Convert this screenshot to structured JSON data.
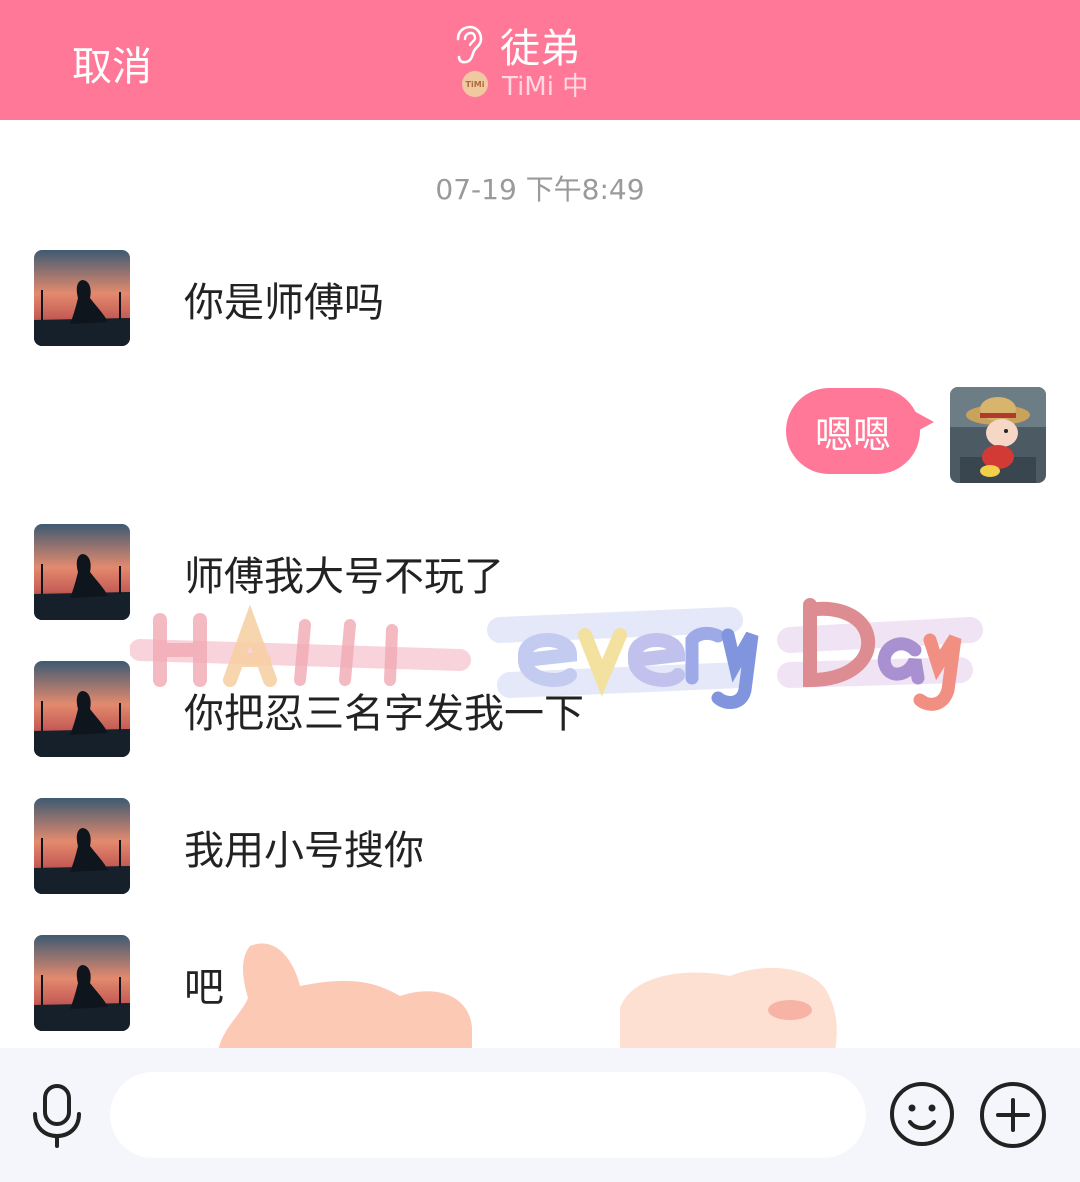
{
  "header": {
    "cancel_label": "取消",
    "title": "徒弟",
    "subtitle": "TiMi 中",
    "timi_badge": "TiMi",
    "title_icon": "ear-icon",
    "background": "#ff7898"
  },
  "chat": {
    "timestamp": "07-19 下午8:49",
    "messages": [
      {
        "from": "other",
        "text": "你是师傅吗"
      },
      {
        "from": "me",
        "text": "嗯嗯"
      },
      {
        "from": "other",
        "text": "师傅我大号不玩了"
      },
      {
        "from": "other",
        "text": "你把忍三名字发我一下"
      },
      {
        "from": "other",
        "text": "我用小号搜你"
      },
      {
        "from": "other",
        "text": "吧"
      }
    ],
    "bubble_color": "#ff7898",
    "background_decoration": "Happy every Day"
  },
  "input_bar": {
    "mic_icon": "microphone-icon",
    "input_value": "",
    "emoji_icon": "smiley-icon",
    "plus_icon": "plus-icon"
  }
}
